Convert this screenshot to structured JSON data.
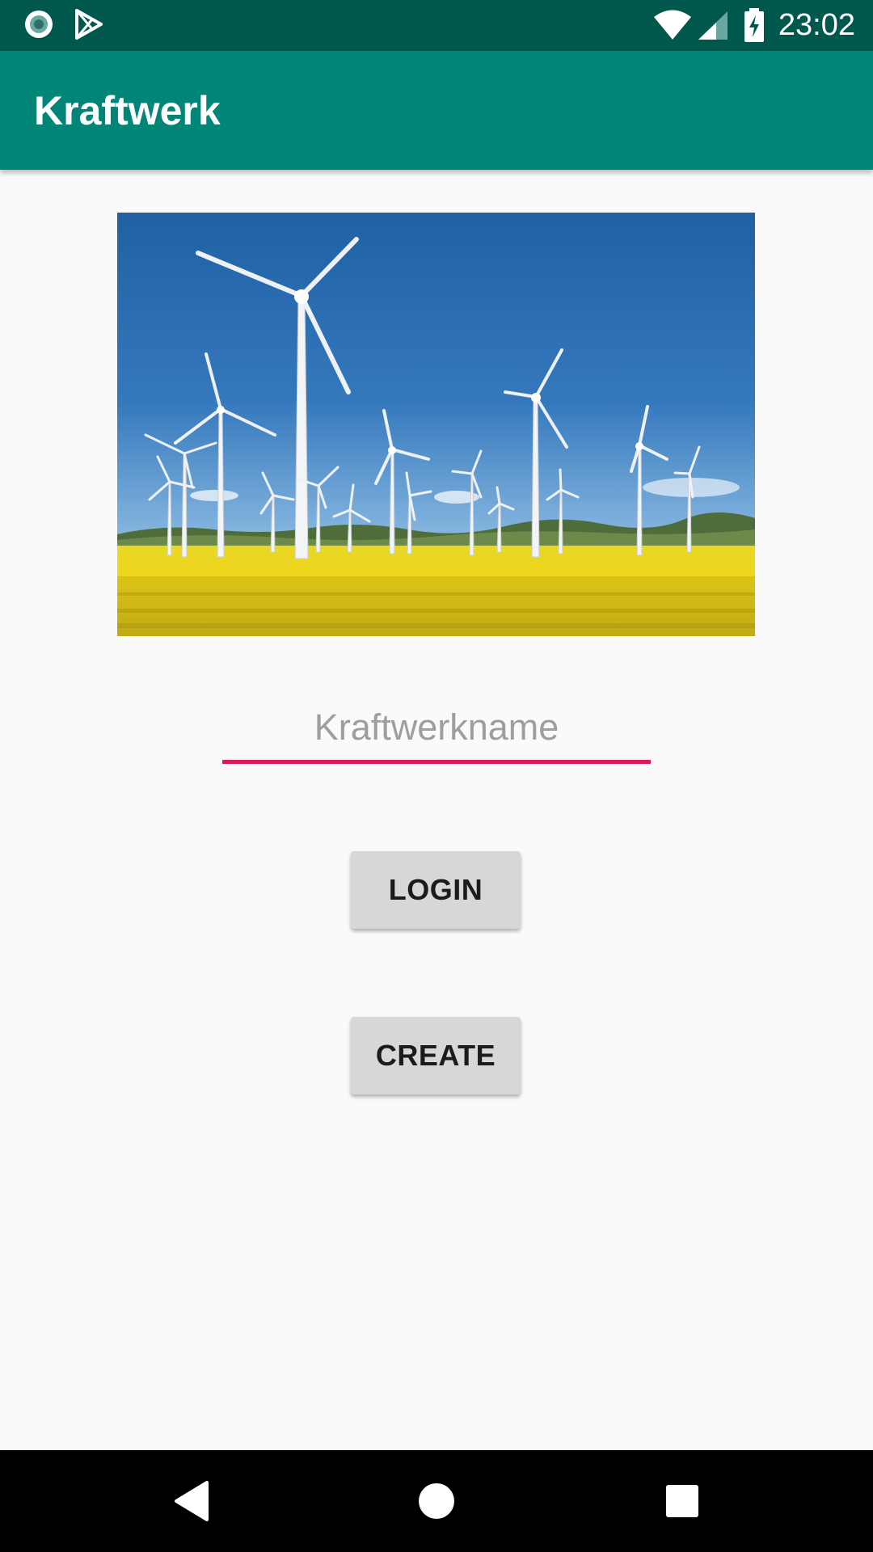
{
  "status_bar": {
    "time": "23:02",
    "left_icons": [
      "record-icon",
      "play-store-icon"
    ],
    "right_icons": [
      "wifi-icon",
      "cell-signal-icon",
      "battery-charging-icon"
    ]
  },
  "app_bar": {
    "title": "Kraftwerk"
  },
  "hero_image": {
    "description": "wind-turbines-rapeseed-field"
  },
  "form": {
    "name_placeholder": "Kraftwerkname",
    "name_value": ""
  },
  "buttons": {
    "login_label": "LOGIN",
    "create_label": "CREATE"
  },
  "nav_bar": {
    "icons": [
      "back-icon",
      "home-icon",
      "recents-icon"
    ]
  },
  "colors": {
    "status_bar": "#00574b",
    "app_bar": "#008577",
    "accent": "#d81b60",
    "background": "#fafafa",
    "button": "#d6d7d7"
  }
}
